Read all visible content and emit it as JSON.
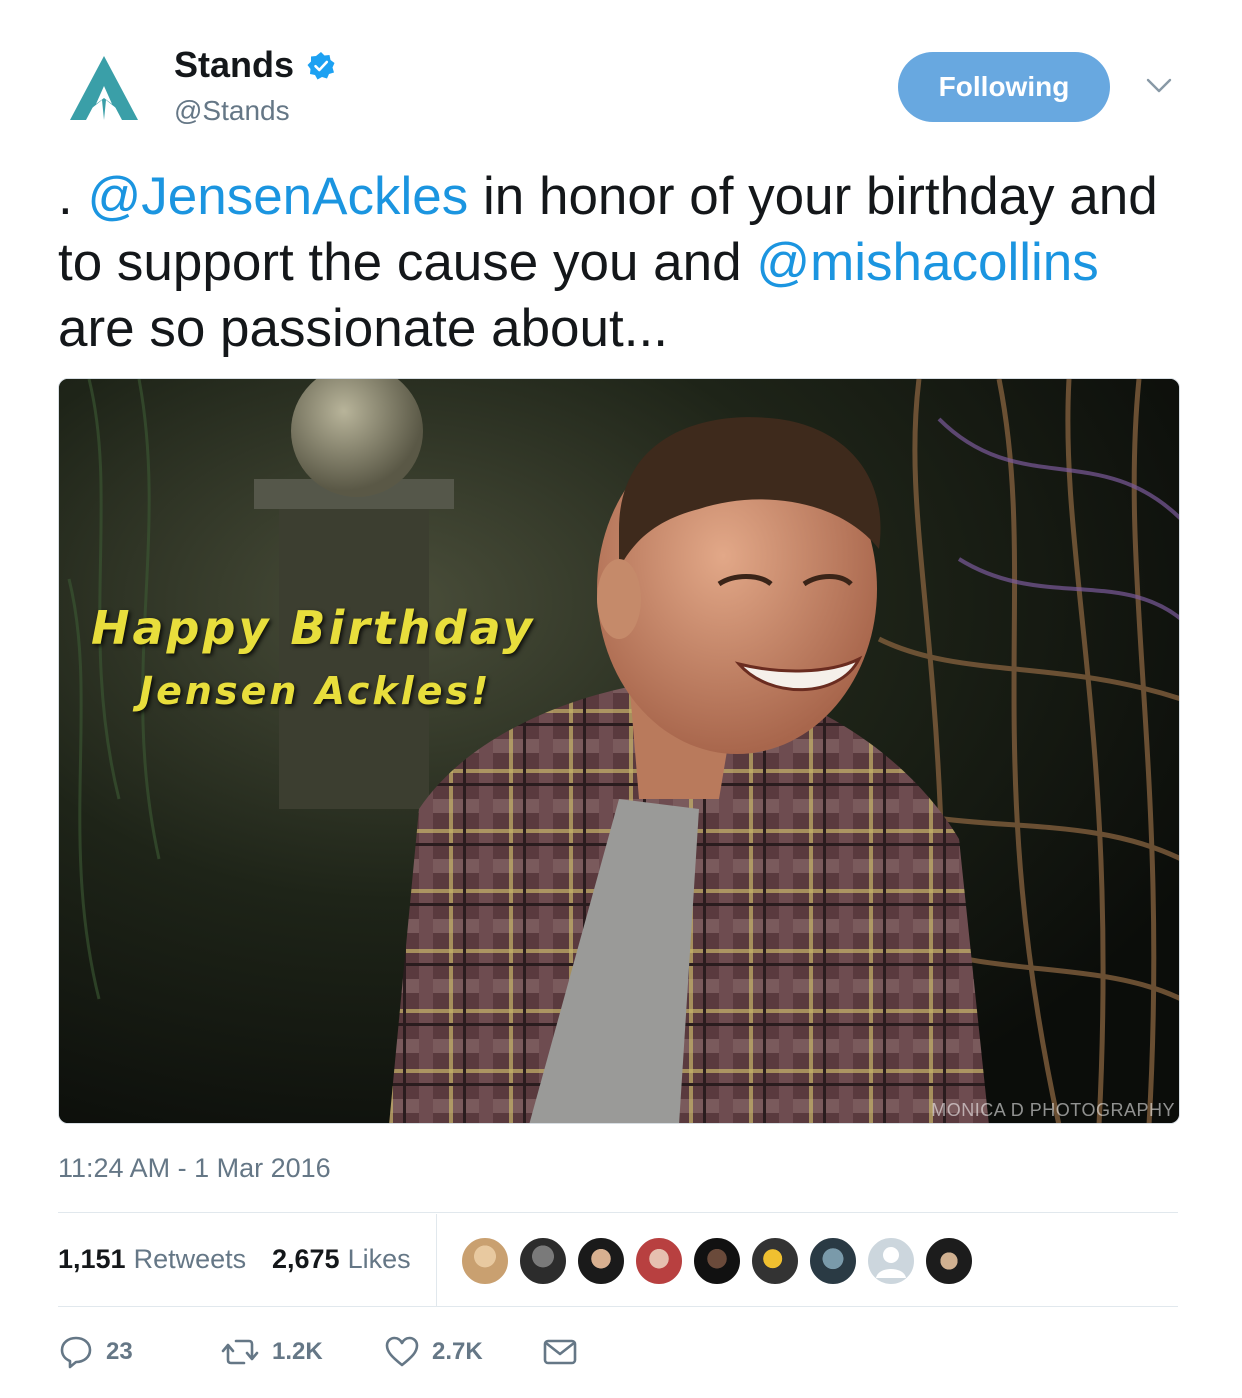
{
  "account": {
    "display_name": "Stands",
    "handle": "@Stands",
    "logo_icon": "stands-logo-icon",
    "verified_icon": "verified-badge-icon",
    "accent": "#68a8e0",
    "logo_color": "#3a9fa8"
  },
  "follow_button": {
    "label": "Following"
  },
  "tweet": {
    "text_prefix": ". ",
    "mention_1": "@JensenAckles",
    "text_mid": " in honor of your birthday and to support the cause you and ",
    "mention_2": "@mishacollins",
    "text_suffix": " are so passionate about..."
  },
  "media": {
    "overlay_line_1": "Happy Birthday",
    "overlay_line_2": "Jensen Ackles!",
    "watermark": "MONICA D PHOTOGRAPHY"
  },
  "timestamp": "11:24 AM - 1 Mar 2016",
  "stats": {
    "retweets_count": "1,151",
    "retweets_label": "Retweets",
    "likes_count": "2,675",
    "likes_label": "Likes"
  },
  "actions": {
    "reply_count": "23",
    "retweet_count": "1.2K",
    "like_count": "2.7K"
  },
  "colors": {
    "link": "#1b95e0",
    "secondary_text": "#657786",
    "divider": "#e1e8ed"
  }
}
